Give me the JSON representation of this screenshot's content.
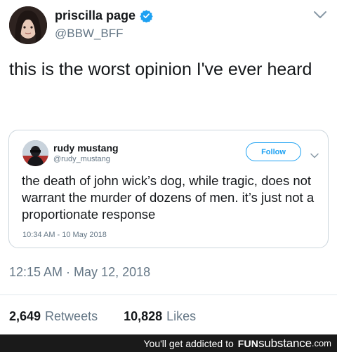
{
  "tweet": {
    "display_name": "priscilla page",
    "handle": "@BBW_BFF",
    "text": "this is the worst opinion I've ever heard",
    "timestamp": "12:15 AM · May 12, 2018",
    "retweets_count": "2,649",
    "retweets_label": "Retweets",
    "likes_count": "10,828",
    "likes_label": "Likes"
  },
  "quoted_tweet": {
    "display_name": "rudy mustang",
    "handle": "@rudy_mustang",
    "follow_label": "Follow",
    "text": "the death of john wick’s dog, while tragic, does not warrant the murder of dozens of men. it’s just not a proportionate response",
    "timestamp": "10:34 AM - 10 May 2018"
  },
  "footer": {
    "tagline": "You'll get addicted to",
    "brand_fun": "FUN",
    "brand_sub": "substance",
    "brand_com": ".com"
  },
  "icons": [
    "avatar",
    "verified-badge-icon",
    "chevron-down-icon"
  ],
  "colors": {
    "accent": "#1da1f2",
    "text": "#14171a",
    "muted": "#657786",
    "border": "#ccd6dd",
    "footer_bg": "#1a1a1a"
  }
}
